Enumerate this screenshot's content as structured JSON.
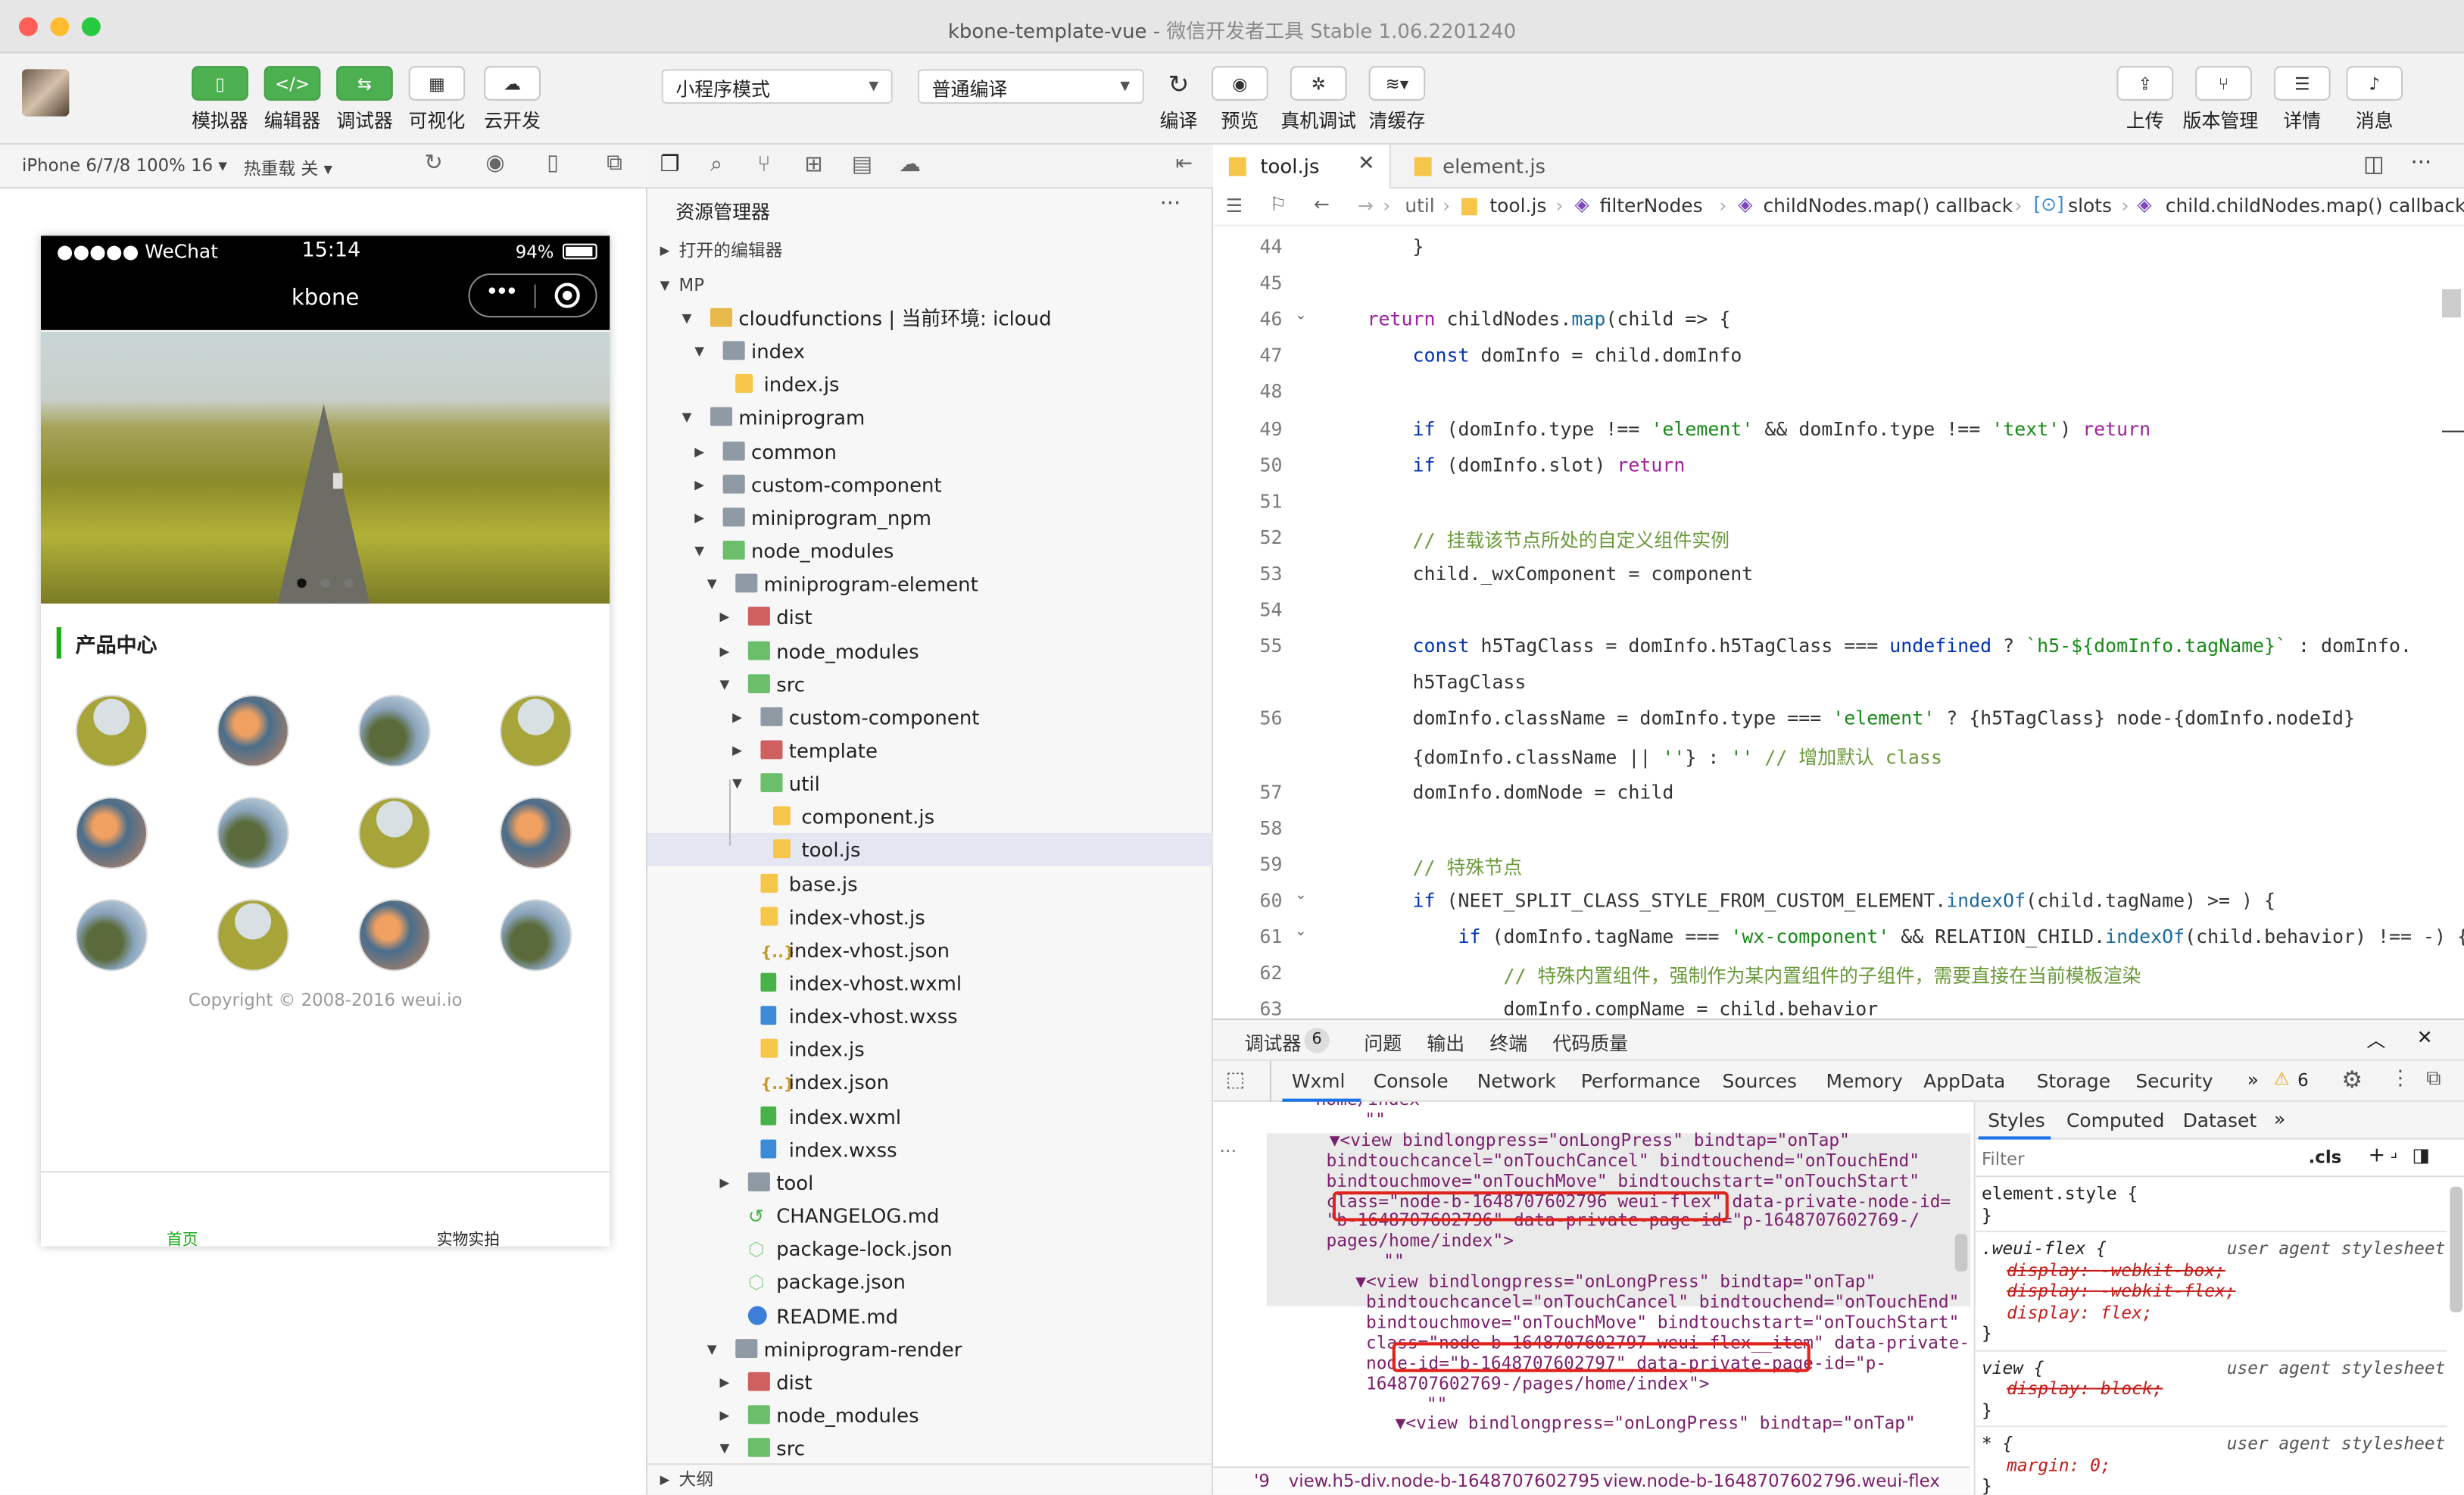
{
  "window": {
    "title": "kbone-template-vue",
    "subtitle": "微信开发者工具 Stable 1.06.2201240"
  },
  "toolbar": {
    "left": [
      {
        "label": "模拟器",
        "icon": "phone-icon"
      },
      {
        "label": "编辑器",
        "icon": "code-icon"
      },
      {
        "label": "调试器",
        "icon": "debug-toggle-icon"
      },
      {
        "label": "可视化",
        "icon": "layout-icon"
      },
      {
        "label": "云开发",
        "icon": "cloud-icon"
      }
    ],
    "mode_select": "小程序模式",
    "compile_select": "普通编译",
    "mid": [
      {
        "label": "编译"
      },
      {
        "label": "预览"
      },
      {
        "label": "真机调试"
      },
      {
        "label": "清缓存"
      }
    ],
    "right": [
      {
        "label": "上传"
      },
      {
        "label": "版本管理"
      },
      {
        "label": "详情"
      },
      {
        "label": "消息"
      }
    ]
  },
  "simulator": {
    "device": "iPhone 6/7/8 100% 16 ▾",
    "hotreload": "热重载 关 ▾",
    "status": {
      "carrier": "●●●●● WeChat",
      "time": "15:14",
      "battery": "94%"
    },
    "nav_title": "kbone",
    "section_title": "产品中心",
    "copyright": "Copyright © 2008-2016 weui.io",
    "tabbar": [
      {
        "label": "首页",
        "active": true
      },
      {
        "label": "实物实拍",
        "active": false
      }
    ]
  },
  "explorer": {
    "title": "资源管理器",
    "open_editors": "打开的编辑器",
    "root": "MP",
    "outline": "大纲",
    "tree": [
      {
        "d": 1,
        "t": "cloudfunctions | 当前环境: icloud",
        "k": "foldy",
        "open": true
      },
      {
        "d": 2,
        "t": "index",
        "k": "fold",
        "open": true
      },
      {
        "d": 3,
        "t": "index.js",
        "k": "js"
      },
      {
        "d": 1,
        "t": "miniprogram",
        "k": "fold",
        "open": true
      },
      {
        "d": 2,
        "t": "common",
        "k": "fold",
        "open": false
      },
      {
        "d": 2,
        "t": "custom-component",
        "k": "fold",
        "open": false
      },
      {
        "d": 2,
        "t": "miniprogram_npm",
        "k": "fold",
        "open": false
      },
      {
        "d": 2,
        "t": "node_modules",
        "k": "foldg",
        "open": true
      },
      {
        "d": 3,
        "t": "miniprogram-element",
        "k": "fold",
        "open": true
      },
      {
        "d": 4,
        "t": "dist",
        "k": "foldr",
        "open": false
      },
      {
        "d": 4,
        "t": "node_modules",
        "k": "foldg",
        "open": false
      },
      {
        "d": 4,
        "t": "src",
        "k": "foldg",
        "open": true
      },
      {
        "d": 5,
        "t": "custom-component",
        "k": "fold",
        "open": false
      },
      {
        "d": 5,
        "t": "template",
        "k": "foldr",
        "open": false
      },
      {
        "d": 5,
        "t": "util",
        "k": "foldg",
        "open": true
      },
      {
        "d": 6,
        "t": "component.js",
        "k": "js"
      },
      {
        "d": 6,
        "t": "tool.js",
        "k": "js",
        "sel": true
      },
      {
        "d": 5,
        "t": "base.js",
        "k": "js"
      },
      {
        "d": 5,
        "t": "index-vhost.js",
        "k": "js"
      },
      {
        "d": 5,
        "t": "index-vhost.json",
        "k": "json"
      },
      {
        "d": 5,
        "t": "index-vhost.wxml",
        "k": "wx"
      },
      {
        "d": 5,
        "t": "index-vhost.wxss",
        "k": "wxs"
      },
      {
        "d": 5,
        "t": "index.js",
        "k": "js"
      },
      {
        "d": 5,
        "t": "index.json",
        "k": "json"
      },
      {
        "d": 5,
        "t": "index.wxml",
        "k": "wx"
      },
      {
        "d": 5,
        "t": "index.wxss",
        "k": "wxs"
      },
      {
        "d": 4,
        "t": "tool",
        "k": "fold",
        "open": false
      },
      {
        "d": 4,
        "t": "CHANGELOG.md",
        "k": "md"
      },
      {
        "d": 4,
        "t": "package-lock.json",
        "k": "pkg"
      },
      {
        "d": 4,
        "t": "package.json",
        "k": "pkg"
      },
      {
        "d": 4,
        "t": "README.md",
        "k": "info"
      },
      {
        "d": 3,
        "t": "miniprogram-render",
        "k": "fold",
        "open": true
      },
      {
        "d": 4,
        "t": "dist",
        "k": "foldr",
        "open": false
      },
      {
        "d": 4,
        "t": "node_modules",
        "k": "foldg",
        "open": false
      },
      {
        "d": 4,
        "t": "src",
        "k": "foldg",
        "open": true
      }
    ]
  },
  "editor": {
    "tabs": [
      {
        "label": "tool.js",
        "active": true
      },
      {
        "label": "element.js",
        "active": false
      }
    ],
    "breadcrumb": [
      "util",
      "tool.js",
      "filterNodes",
      "childNodes.map() callback",
      "slots",
      "child.childNodes.map() callback"
    ],
    "lines": [
      {
        "n": "44",
        "html": "    }"
      },
      {
        "n": "45",
        "html": ""
      },
      {
        "n": "46",
        "html": "return childNodes.map(child => {"
      },
      {
        "n": "47",
        "html": "    const domInfo = child.$$domInfo"
      },
      {
        "n": "48",
        "html": ""
      },
      {
        "n": "49",
        "html": "    if (domInfo.type !== 'element' && domInfo.type !== 'text') return"
      },
      {
        "n": "50",
        "html": "    if (domInfo.slot) return"
      },
      {
        "n": "51",
        "html": ""
      },
      {
        "n": "52",
        "html": "    // 挂载该节点所处的自定义组件实例"
      },
      {
        "n": "53",
        "html": "    child._wxComponent = component"
      },
      {
        "n": "54",
        "html": ""
      },
      {
        "n": "55",
        "html": "    const h5TagClass = domInfo.h5TagClass === undefined ? `h5-${domInfo.tagName}` : domInfo."
      },
      {
        "n": "",
        "html": "    h5TagClass"
      },
      {
        "n": "56",
        "html": "    domInfo.className = domInfo.type === 'element' ? `${h5TagClass} node-${domInfo.nodeId} $"
      },
      {
        "n": "",
        "html": "    {domInfo.className || ''}` : '' // 增加默认 class"
      },
      {
        "n": "57",
        "html": "    domInfo.domNode = child"
      },
      {
        "n": "58",
        "html": ""
      },
      {
        "n": "59",
        "html": "    // 特殊节点"
      },
      {
        "n": "60",
        "html": "    if (NEET_SPLIT_CLASS_STYLE_FROM_CUSTOM_ELEMENT.indexOf(child.tagName) >= 0) {"
      },
      {
        "n": "61",
        "html": "        if (domInfo.tagName === 'wx-component' && RELATION_CHILD.indexOf(child.behavior) !== -1) {"
      },
      {
        "n": "62",
        "html": "            // 特殊内置组件，强制作为某内置组件的子组件，需要直接在当前模板渲染"
      },
      {
        "n": "63",
        "html": "            domInfo.compName = child.behavior"
      }
    ]
  },
  "devtools": {
    "top_tabs": [
      "调试器",
      "问题",
      "输出",
      "终端",
      "代码质量"
    ],
    "badge": "6",
    "panel_tabs": [
      "Wxml",
      "Console",
      "Network",
      "Performance",
      "Sources",
      "Memory",
      "AppData",
      "Storage",
      "Security"
    ],
    "warn_count": "6",
    "style_tabs": [
      "Styles",
      "Computed",
      "Dataset"
    ],
    "filter_placeholder": "Filter",
    "cls": ".cls",
    "wxml": [
      "  home/index\"",
      "    \"\"",
      "▼<view bindlongpress=\"onLongPress\" bindtap=\"onTap\"",
      "bindtouchcancel=\"onTouchCancel\" bindtouchend=\"onTouchEnd\"",
      "bindtouchmove=\"onTouchMove\" bindtouchstart=\"onTouchStart\"",
      "class=\"node-b-1648707602796 weui-flex\" data-private-node-id=",
      "\"b-1648707602796\" data-private-page-id=\"p-1648707602769-/",
      "pages/home/index\">",
      "    \"\"",
      " ▼<view bindlongpress=\"onLongPress\" bindtap=\"onTap\"",
      "  bindtouchcancel=\"onTouchCancel\" bindtouchend=\"onTouchEnd\"",
      "  bindtouchmove=\"onTouchMove\" bindtouchstart=\"onTouchStart\"",
      "  class=\"node-b-1648707602797 weui-flex__item\" data-private-",
      "  node-id=\"b-1648707602797\" data-private-page-id=\"p-",
      "  1648707602769-/pages/home/index\">",
      "      \"\"",
      "   ▼<view bindlongpress=\"onLongPress\" bindtap=\"onTap\""
    ],
    "dom_crumbs": [
      "'9",
      "view.h5-div.node-b-1648707602795",
      "view.node-b-1648707602796.weui-flex"
    ],
    "styles": [
      {
        "sel": "element.style {",
        "lines": [],
        "src": ""
      },
      {
        "sel": ".weui-flex {",
        "lines": [
          {
            "t": "display: -webkit-box;",
            "strike": true
          },
          {
            "t": "display: -webkit-flex;",
            "strike": true
          },
          {
            "t": "display: flex;",
            "strike": false
          }
        ],
        "src": "user agent stylesheet"
      },
      {
        "sel": "view {",
        "lines": [
          {
            "t": "display: block;",
            "strike": true
          }
        ],
        "src": "user agent stylesheet"
      },
      {
        "sel": "* {",
        "lines": [
          {
            "t": "margin: 0;",
            "strike": false
          }
        ],
        "src": "user agent stylesheet"
      }
    ]
  }
}
